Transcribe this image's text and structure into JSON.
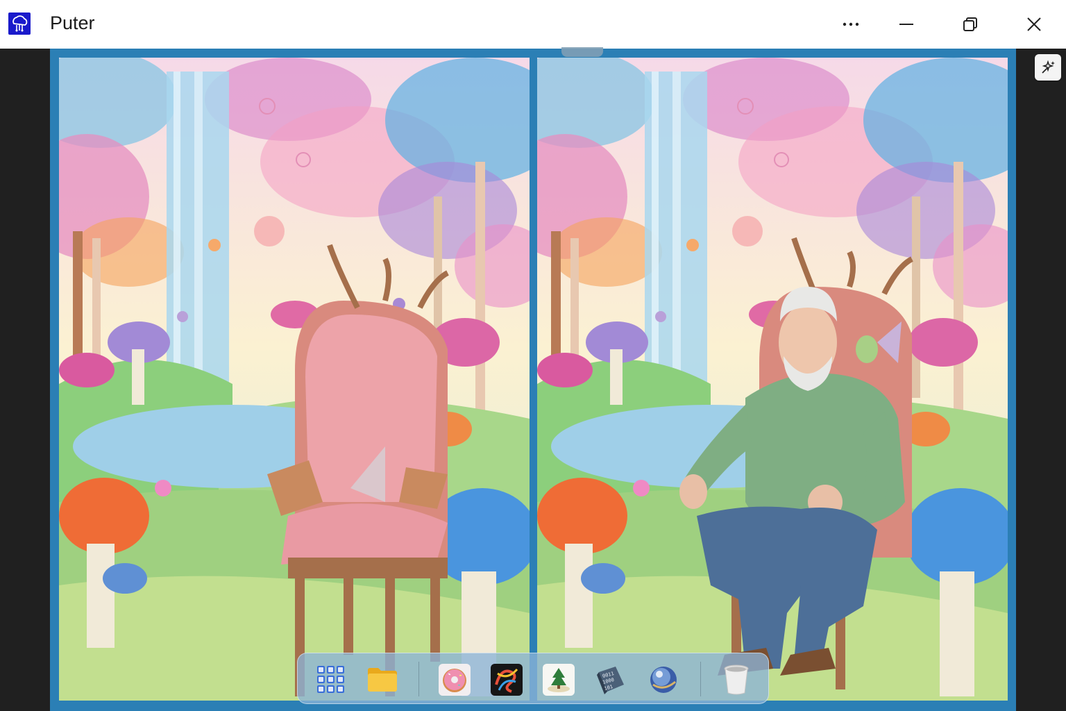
{
  "window": {
    "title": "Puter",
    "more_label": "More options",
    "minimize_label": "Minimize",
    "maximize_label": "Restore",
    "close_label": "Close"
  },
  "toolbar": {
    "ai_button_label": "AI"
  },
  "dock": {
    "items": [
      {
        "name": "app-launcher",
        "icon": "grid-icon"
      },
      {
        "name": "file-explorer",
        "icon": "folder-icon"
      },
      {
        "name": "donut-app",
        "icon": "donut-icon"
      },
      {
        "name": "art-app",
        "icon": "swirl-art-icon"
      },
      {
        "name": "tree-app",
        "icon": "pine-tree-icon"
      },
      {
        "name": "binary-app",
        "icon": "binary-cube-icon"
      },
      {
        "name": "browser-app",
        "icon": "globe-icon"
      },
      {
        "name": "trash",
        "icon": "trash-icon"
      }
    ]
  },
  "colors": {
    "frame": "#2b7fb5",
    "title_bg": "#ffffff",
    "logo": "#1a1acb"
  }
}
